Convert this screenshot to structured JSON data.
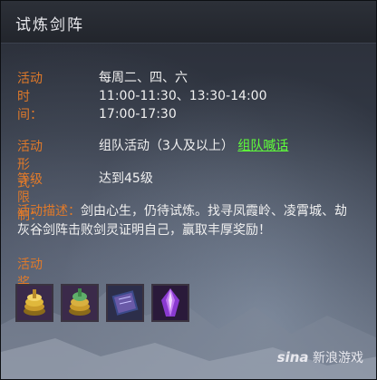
{
  "window": {
    "title": "试炼剑阵"
  },
  "activity": {
    "time_label": "活动时间：",
    "time_lines": [
      "每周二、四、六",
      "11:00-11:30、13:30-14:00",
      "17:00-17:30"
    ],
    "form_label": "活动形式：",
    "form_value": "组队活动（3人及以上）",
    "form_link": "组队喊话",
    "level_label": "等级限制：",
    "level_value": "达到45级",
    "desc_label": "活动描述：",
    "desc_value": "剑由心生，仍待试炼。找寻凤霞岭、凌霄城、劫灰谷剑阵击败剑灵证明自己，赢取丰厚奖励！",
    "reward_label": "活动奖励："
  },
  "rewards": [
    {
      "icon": "gold-coin-stack-icon"
    },
    {
      "icon": "jade-coin-stack-icon"
    },
    {
      "icon": "skill-book-icon"
    },
    {
      "icon": "purple-crystal-icon"
    }
  ],
  "watermark": {
    "brand": "sina",
    "text": "新浪游戏"
  }
}
